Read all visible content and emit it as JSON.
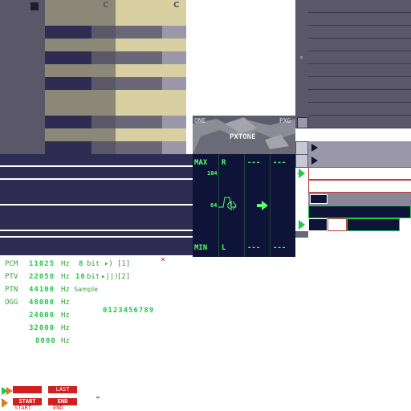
{
  "piano": {
    "c_label_left": "C",
    "c_label_right": "C"
  },
  "logo": {
    "tl": "ONE",
    "tr": "PXG",
    "center": "PXTONE"
  },
  "volume": {
    "max": "MAX",
    "min": "MIN",
    "r": "R",
    "l": "L",
    "v104": "104",
    "v64": "64",
    "dash1": "---",
    "dash2": "---",
    "dash3": "---",
    "dash4": "---"
  },
  "formats": [
    {
      "label": "PCM",
      "rate": "11025",
      "unit": "Hz",
      "bits": "8",
      "bits_unit": "bit",
      "ch": "[1]"
    },
    {
      "label": "PTV",
      "rate": "22050",
      "unit": "Hz",
      "bits": "16",
      "bits_unit": "bit",
      "ch": "[2]"
    },
    {
      "label": "PTN",
      "rate": "44100",
      "unit": "Hz",
      "extra": "Sample"
    },
    {
      "label": "OGG",
      "rate": "48000",
      "unit": "Hz"
    }
  ],
  "rates_extra": [
    {
      "rate": "24000",
      "unit": "Hz"
    },
    {
      "rate": "32000",
      "unit": "Hz"
    },
    {
      "rate": "8000",
      "unit": "Hz"
    }
  ],
  "digits": "0123456789",
  "close_mark": "×",
  "buttons": {
    "start": "START",
    "start_sub": "START",
    "end": "END",
    "end_sub": "END",
    "last": "LAST"
  },
  "colors": {
    "green": "#21c84a",
    "red": "#d02020",
    "navy": "#0e1438"
  }
}
